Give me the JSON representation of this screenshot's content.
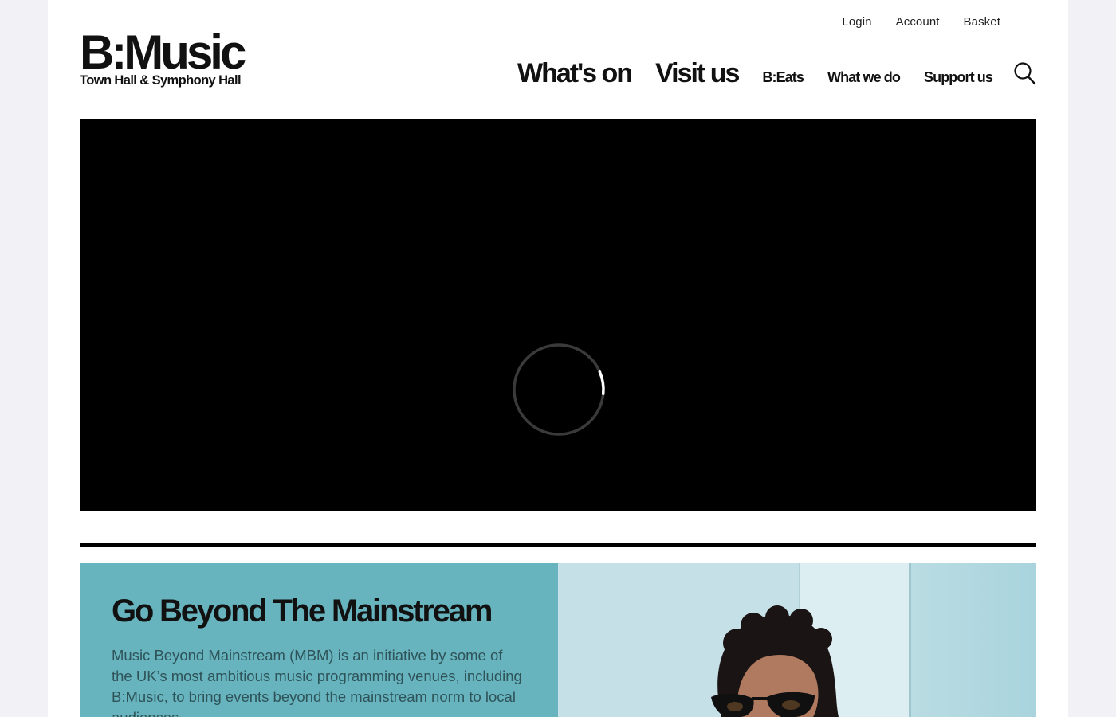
{
  "header": {
    "logo": {
      "main": "B:Music",
      "sub": "Town Hall & Symphony Hall"
    },
    "utility_nav": [
      "Login",
      "Account",
      "Basket"
    ],
    "main_nav": [
      {
        "label": "What's on",
        "size": "big"
      },
      {
        "label": "Visit us",
        "size": "big"
      },
      {
        "label": "B:Eats",
        "size": "small"
      },
      {
        "label": "What we do",
        "size": "small"
      },
      {
        "label": "Support us",
        "size": "small"
      }
    ],
    "search_icon": "search-icon"
  },
  "hero": {
    "media": "video",
    "state_icon": "loading-spinner-icon",
    "loading_progress": 0.08
  },
  "promo": {
    "title": "Go Beyond The Mainstream",
    "body": "Music Beyond Mainstream (MBM) is an initiative by some of the UK’s most ambitious music programming venues, including B:Music, to bring events beyond the mainstream norm to local audiences.",
    "image": "woman-in-sunglasses-photo"
  },
  "colors": {
    "page_background": "#f1f1f6",
    "promo_background": "#67b4bf",
    "video_background": "#000000",
    "text": "#111111"
  }
}
